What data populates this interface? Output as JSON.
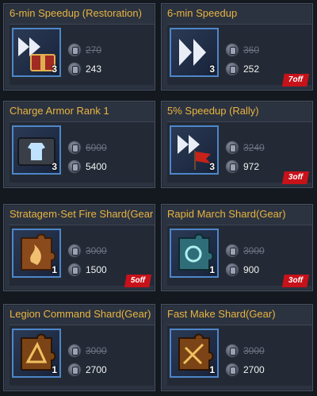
{
  "items": [
    {
      "title": "6-min Speedup (Restoration)",
      "icon": "speedup-chest-icon",
      "qty": "3",
      "old_price": "270",
      "new_price": "243",
      "badge": ""
    },
    {
      "title": "6-min Speedup",
      "icon": "speedup-arrows-icon",
      "qty": "3",
      "old_price": "360",
      "new_price": "252",
      "badge": "7off"
    },
    {
      "title": "Charge Armor Rank 1",
      "icon": "armor-case-icon",
      "qty": "3",
      "old_price": "6000",
      "new_price": "5400",
      "badge": ""
    },
    {
      "title": "5% Speedup (Rally)",
      "icon": "rally-speedup-flag-icon",
      "qty": "3",
      "old_price": "3240",
      "new_price": "972",
      "badge": "3off"
    },
    {
      "title": "Stratagem·Set Fire Shard(Gear)",
      "icon": "puzzle-shard-fire-icon",
      "qty": "1",
      "old_price": "3000",
      "new_price": "1500",
      "badge": "5off"
    },
    {
      "title": "Rapid March Shard(Gear)",
      "icon": "puzzle-shard-teal-icon",
      "qty": "1",
      "old_price": "3000",
      "new_price": "900",
      "badge": "3off"
    },
    {
      "title": "Legion Command Shard(Gear)",
      "icon": "puzzle-shard-gold-icon",
      "qty": "1",
      "old_price": "3000",
      "new_price": "2700",
      "badge": ""
    },
    {
      "title": "Fast Make Shard(Gear)",
      "icon": "puzzle-shard-gold-icon",
      "qty": "1",
      "old_price": "3000",
      "new_price": "2700",
      "badge": ""
    }
  ],
  "colors": {
    "title": "#e8b441",
    "frame": "#4e86c8",
    "badge": "#c8121a"
  }
}
